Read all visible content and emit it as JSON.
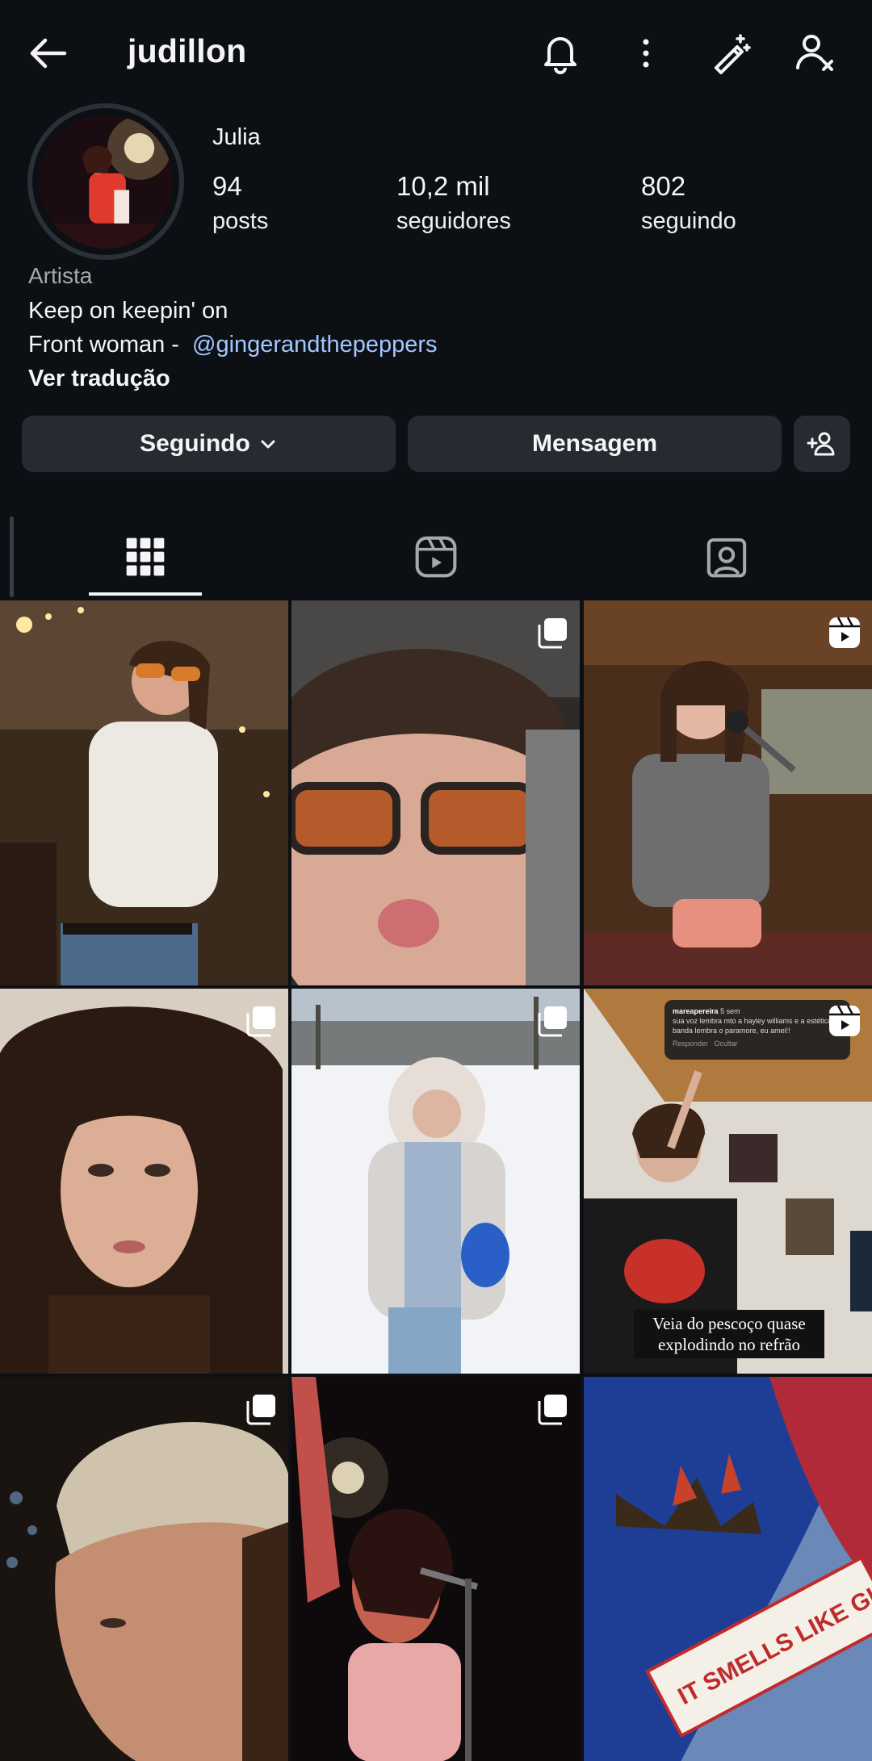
{
  "header": {
    "username": "judillon",
    "icons": [
      "back-arrow-icon",
      "bell-icon",
      "more-vertical-icon",
      "magic-wand-icon",
      "remove-user-icon"
    ]
  },
  "profile": {
    "name": "Julia",
    "stats": [
      {
        "value": "94",
        "label": "posts"
      },
      {
        "value": "10,2 mil",
        "label": "seguidores"
      },
      {
        "value": "802",
        "label": "seguindo"
      }
    ],
    "category": "Artista",
    "bio_line1": "Keep on keepin' on",
    "bio_line2_prefix": "Front woman - ",
    "bio_mention": "@gingerandthepeppers",
    "translate": "Ver tradução"
  },
  "actions": {
    "following_label": "Seguindo",
    "message_label": "Mensagem"
  },
  "tabs": [
    {
      "name": "grid-tab",
      "icon": "grid-icon",
      "active": true
    },
    {
      "name": "reels-tab",
      "icon": "reels-icon",
      "active": false
    },
    {
      "name": "tagged-tab",
      "icon": "tagged-icon",
      "active": false
    }
  ],
  "grid": {
    "posts": [
      {
        "badge": "none",
        "desc": "woman in white tee with orange sunglasses in studio"
      },
      {
        "badge": "carousel-icon",
        "desc": "close-up face with tinted glasses"
      },
      {
        "badge": "reels-icon",
        "desc": "woman singing into microphone in studio"
      },
      {
        "badge": "carousel-icon",
        "desc": "portrait with long dark hair"
      },
      {
        "badge": "carousel-icon",
        "desc": "woman in fur hood in snowy park"
      },
      {
        "badge": "reels-icon",
        "desc": "woman singing in recording studio"
      },
      {
        "badge": "carousel-icon",
        "desc": "profile with beige beanie"
      },
      {
        "badge": "carousel-icon",
        "desc": "singer on stage with microphone"
      },
      {
        "badge": "none",
        "desc": "artwork with jeans and chili peppers"
      }
    ],
    "comment_overlay": {
      "user": "mareapereira",
      "time": "5 sem",
      "text": "sua voz lembra mto a hayley williams e a estética da banda lembra o paramore, eu amei!!",
      "reply": "Responder",
      "hide": "Ocultar"
    },
    "video_caption": "Veia do pescoço quase explodindo no refrão",
    "artwork_text": "IT SMELLS LIKE GINGER"
  },
  "colors": {
    "background": "#0c1014",
    "button": "#262b31",
    "mention": "#a4c7ff",
    "muted": "#a8a8a8"
  }
}
